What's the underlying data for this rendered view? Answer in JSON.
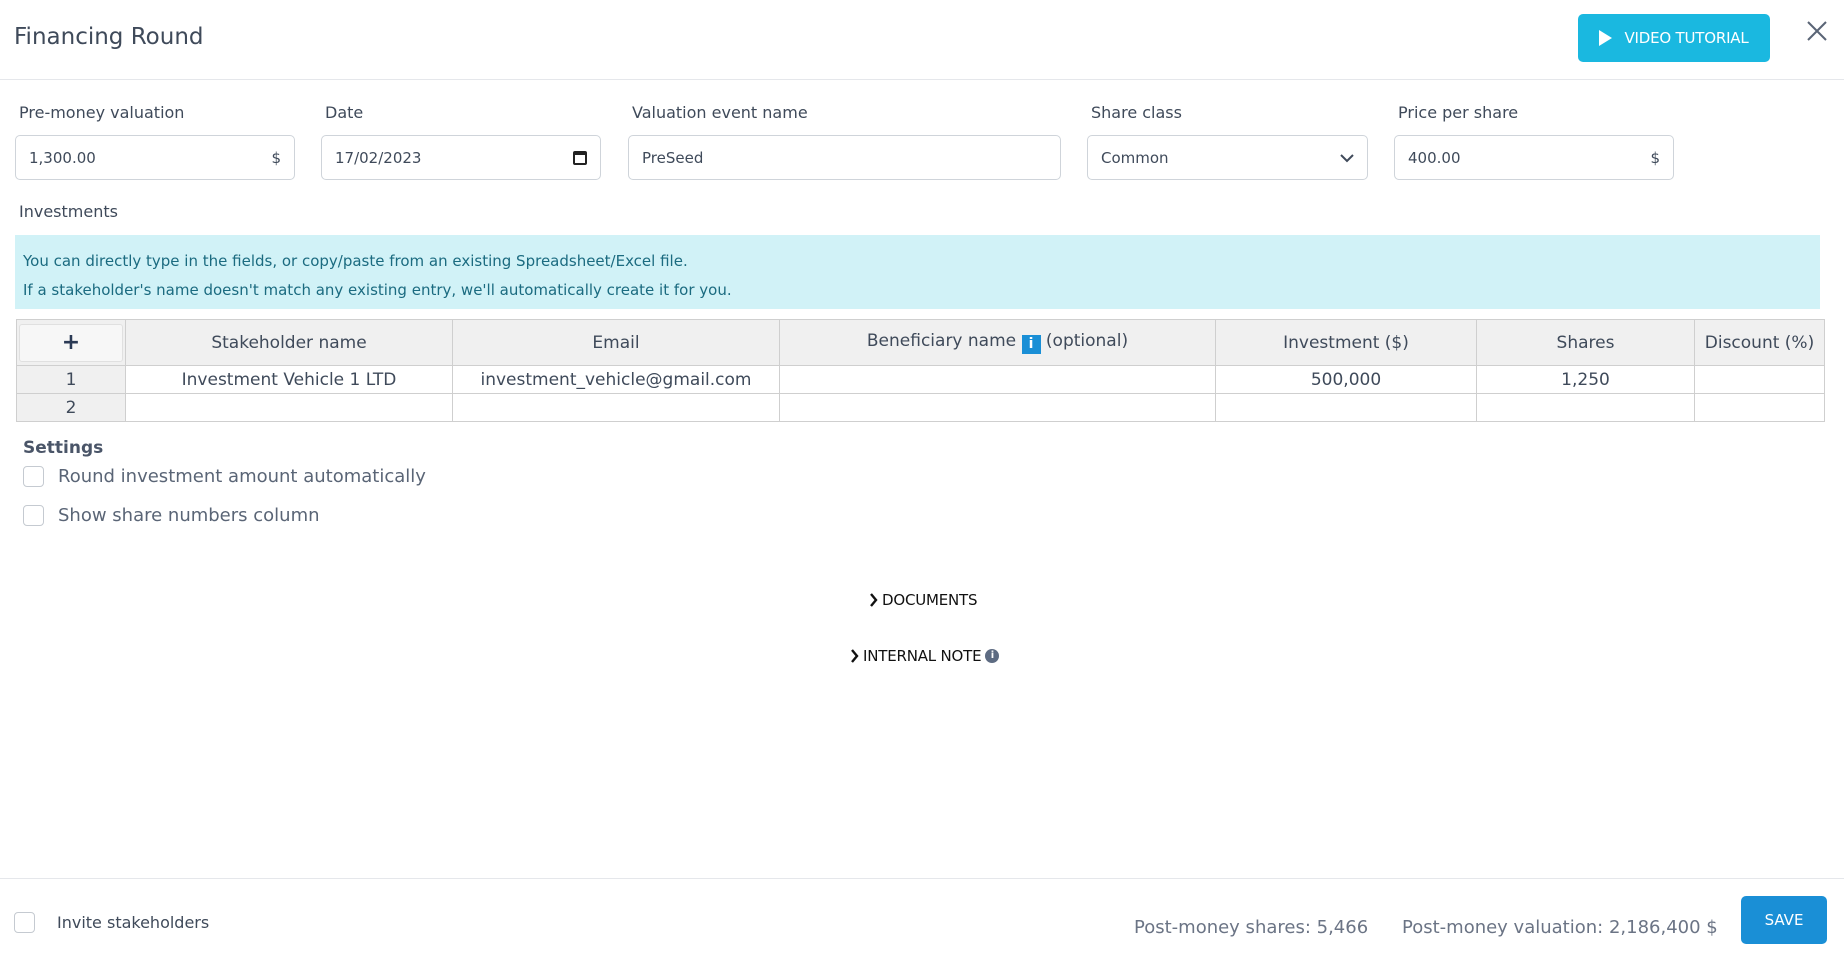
{
  "header": {
    "title": "Financing Round",
    "video_label": "VIDEO TUTORIAL"
  },
  "fields": {
    "pre_money": {
      "label": "Pre-money valuation",
      "value": "1,300.00",
      "suffix": "$"
    },
    "date": {
      "label": "Date",
      "value": "17/02/2023"
    },
    "event_name": {
      "label": "Valuation event name",
      "value": "PreSeed"
    },
    "share_class": {
      "label": "Share class",
      "value": "Common"
    },
    "price_per_share": {
      "label": "Price per share",
      "value": "400.00",
      "suffix": "$"
    }
  },
  "investments": {
    "label": "Investments",
    "info_line1": "You can directly type in the fields, or copy/paste from an existing Spreadsheet/Excel file.",
    "info_line2": "If a stakeholder's name doesn't match any existing entry, we'll automatically create it for you.",
    "add_label": "+",
    "columns": {
      "stakeholder": "Stakeholder name",
      "email": "Email",
      "beneficiary": "Beneficiary name",
      "beneficiary_icon": "i",
      "beneficiary_optional": "(optional)",
      "investment": "Investment ($)",
      "shares": "Shares",
      "discount": "Discount (%)"
    },
    "rows": [
      {
        "num": "1",
        "stakeholder": "Investment Vehicle 1 LTD",
        "email": "investment_vehicle@gmail.com",
        "beneficiary": "",
        "investment": "500,000",
        "shares": "1,250",
        "discount": ""
      },
      {
        "num": "2",
        "stakeholder": "",
        "email": "",
        "beneficiary": "",
        "investment": "",
        "shares": "",
        "discount": ""
      }
    ]
  },
  "settings": {
    "title": "Settings",
    "round_label": "Round investment amount automatically",
    "show_shares_label": "Show share numbers column"
  },
  "sections": {
    "documents": "DOCUMENTS",
    "internal_note": "INTERNAL NOTE",
    "info_icon": "i"
  },
  "footer": {
    "invite_label": "Invite stakeholders",
    "post_money_shares": "Post-money shares: 5,466",
    "post_money_valuation": "Post-money valuation: 2,186,400 $",
    "save_label": "SAVE"
  }
}
